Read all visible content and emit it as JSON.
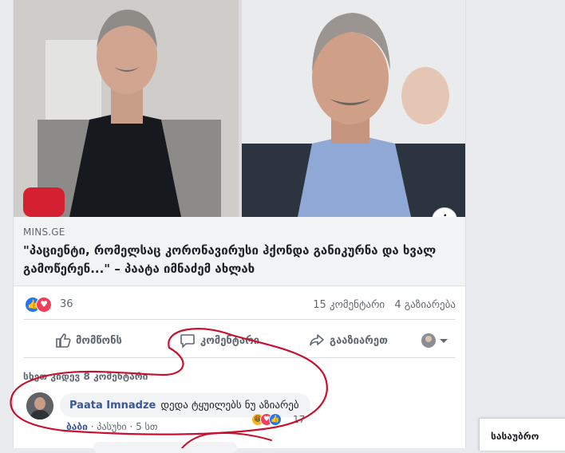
{
  "link_preview": {
    "source": "MINS.GE",
    "headline": "\"პაციენტი, რომელსაც კორონავირუსი ჰქონდა განიკურნა და ხვალ გამოწერენ...\" – პაატა იმნაძემ ახლახ",
    "info_icon": "i"
  },
  "stats": {
    "reaction_count": "36",
    "comments": "15 კომენტარი",
    "shares": "4 გაზიარება"
  },
  "actions": {
    "like": "მომწონს",
    "comment": "კომენტარი",
    "share": "გააზიარეთ"
  },
  "comments_section": {
    "view_more": "სხეთ კიდევ 8 კომენტარი",
    "comment": {
      "author": "Paata Imnadze",
      "text": "დედა ტყუილებს ნუ აზიარებ",
      "reaction_count": "17",
      "like_link": "ბაბი",
      "reply_link": "პასუხი",
      "time": "5 სთ"
    }
  },
  "chat": {
    "label": "სასაუბრო"
  },
  "colors": {
    "brand_link": "#385898",
    "like_blue": "#2078f4",
    "love_red": "#f33e58",
    "annotation_red": "#c8102e"
  }
}
